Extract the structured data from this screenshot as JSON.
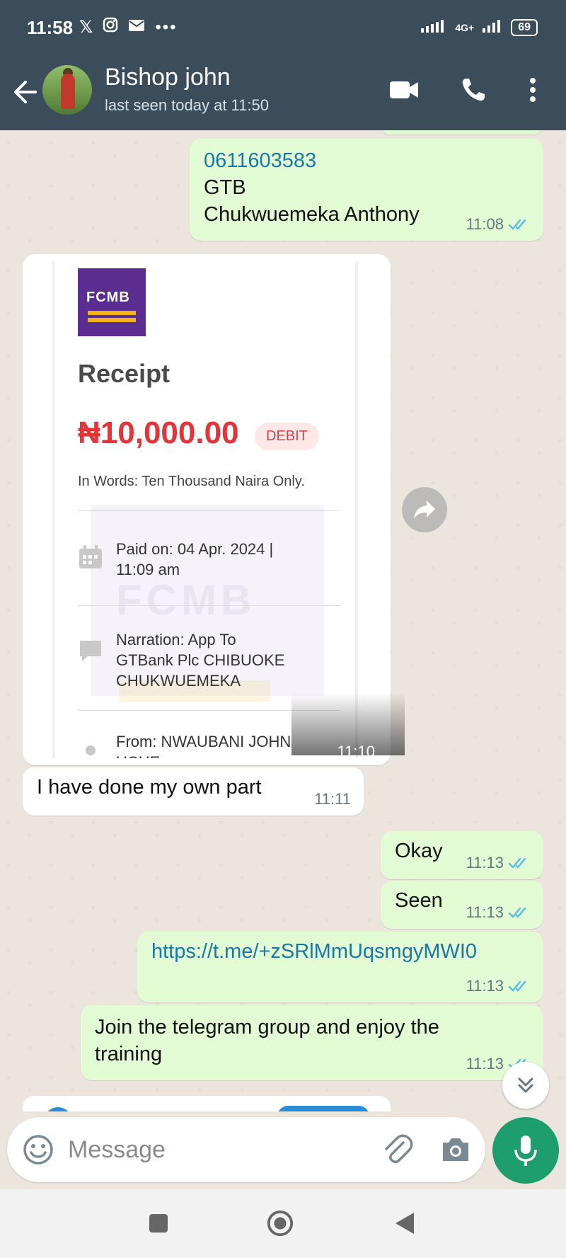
{
  "status_bar": {
    "time": "11:58",
    "icons": [
      "x-icon",
      "instagram-icon",
      "mail-icon",
      "more-icon"
    ],
    "network": "4G+",
    "battery": "69"
  },
  "header": {
    "contact_name": "Bishop john",
    "last_seen": "last seen today at 11:50",
    "icons": [
      "back-arrow-icon",
      "video-call-icon",
      "phone-icon",
      "kebab-menu-icon"
    ]
  },
  "messages": [
    {
      "type": "out",
      "lines": [
        "0611603583",
        "GTB",
        "Chukwuemeka Anthony"
      ],
      "time": "11:08",
      "status": "read"
    },
    {
      "type": "in-image",
      "time": "11:10"
    },
    {
      "type": "in",
      "text": "I have done my own part",
      "time": "11:11"
    },
    {
      "type": "out",
      "text": "Okay",
      "time": "11:13",
      "status": "read"
    },
    {
      "type": "out",
      "text": "Seen",
      "time": "11:13",
      "status": "read"
    },
    {
      "type": "out",
      "text": "https://t.me/+zSRlMmUqsmgyMWI0",
      "time": "11:13",
      "status": "read"
    },
    {
      "type": "out",
      "lines": [
        "Join the telegram group and enjoy the",
        "training"
      ],
      "time": "11:13",
      "status": "read"
    }
  ],
  "receipt": {
    "bank": "FCMB",
    "title": "Receipt",
    "amount": "₦10,000.00",
    "badge": "DEBIT",
    "in_words": "In Words: Ten Thousand Naira  Only.",
    "paid_on_line1": "Paid on: 04 Apr. 2024 |",
    "paid_on_line2": "11:09 am",
    "narration_line1": "Narration: App To",
    "narration_line2": "GTBank Plc CHIBUOKE",
    "narration_line3": "CHUKWUEMEKA",
    "from_line1": "From: NWAUBANI JOHN",
    "from_line2": "UCHE"
  },
  "composer": {
    "placeholder": "Message"
  },
  "colors": {
    "header_bg": "#3b4d5b",
    "outgoing_bubble": "#e2fbd4",
    "incoming_bubble": "#ffffff",
    "read_ticks": "#53bdeb",
    "mic_button": "#1e9e6f",
    "fcmb_purple": "#5c2d91",
    "amount_red": "#e3343a"
  }
}
